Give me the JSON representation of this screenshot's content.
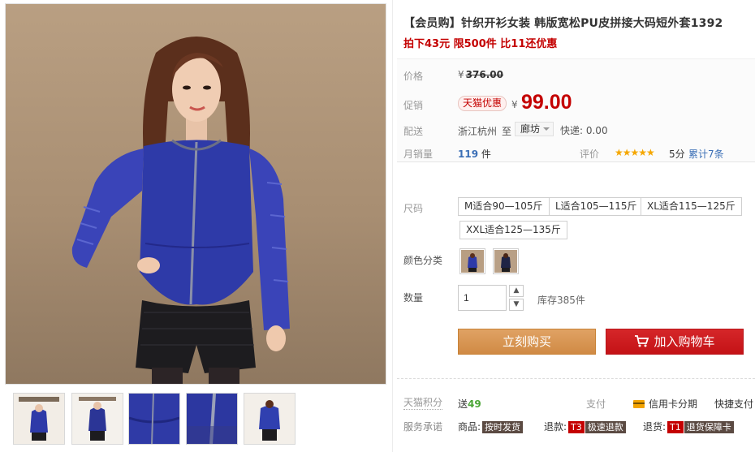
{
  "product": {
    "title": "【会员购】针织开衫女装 韩版宽松PU皮拼接大码短外套1392",
    "subtitle": "拍下43元 限500件 比11还优惠"
  },
  "pricing": {
    "price_label": "价格",
    "currency": "¥",
    "original_price": "376.00",
    "promo_label": "促销",
    "promo_tag": "天猫优惠",
    "promo_price": "99.00"
  },
  "shipping": {
    "label": "配送",
    "origin": "浙江杭州",
    "to": "至",
    "destination": "廊坊",
    "express": "快递: 0.00"
  },
  "sales": {
    "monthly_label": "月销量",
    "monthly_count": "119",
    "unit": "件",
    "rating_label": "评价",
    "stars": "★★★★★",
    "score": "5分",
    "review_count": "累计7条"
  },
  "options": {
    "size_label": "尺码",
    "sizes": [
      "M适合90—105斤",
      "L适合105—115斤",
      "XL适合115—125斤",
      "XXL适合125—135斤"
    ],
    "color_label": "颜色分类",
    "colors": [
      "blue-jacket-front",
      "blue-jacket-side"
    ],
    "quantity_label": "数量",
    "quantity": "1",
    "stock": "库存385件"
  },
  "actions": {
    "buy_now": "立刻购买",
    "add_to_cart": "加入购物车"
  },
  "services": {
    "points_label": "天猫积分",
    "points_prefix": "送",
    "points_value": "49",
    "pay_label": "支付",
    "credit_card": "信用卡分期",
    "fast_pay": "快捷支付",
    "promise_label": "服务承诺",
    "goods_label": "商品:",
    "goods_badge": "按时发货",
    "refund_label": "退款:",
    "refund_code": "T3",
    "refund_badge": "极速退款",
    "return_label": "退货:",
    "return_code": "T1",
    "return_badge": "退货保障卡"
  },
  "thumbnails": [
    "logo-card",
    "full-body",
    "detail-closeup",
    "zipper-detail",
    "side-view"
  ],
  "colors": {
    "accent_red": "#c40000",
    "buy_orange": "#d08a44",
    "cart_red": "#c41216",
    "jacket_blue": "#2e3aa8"
  }
}
